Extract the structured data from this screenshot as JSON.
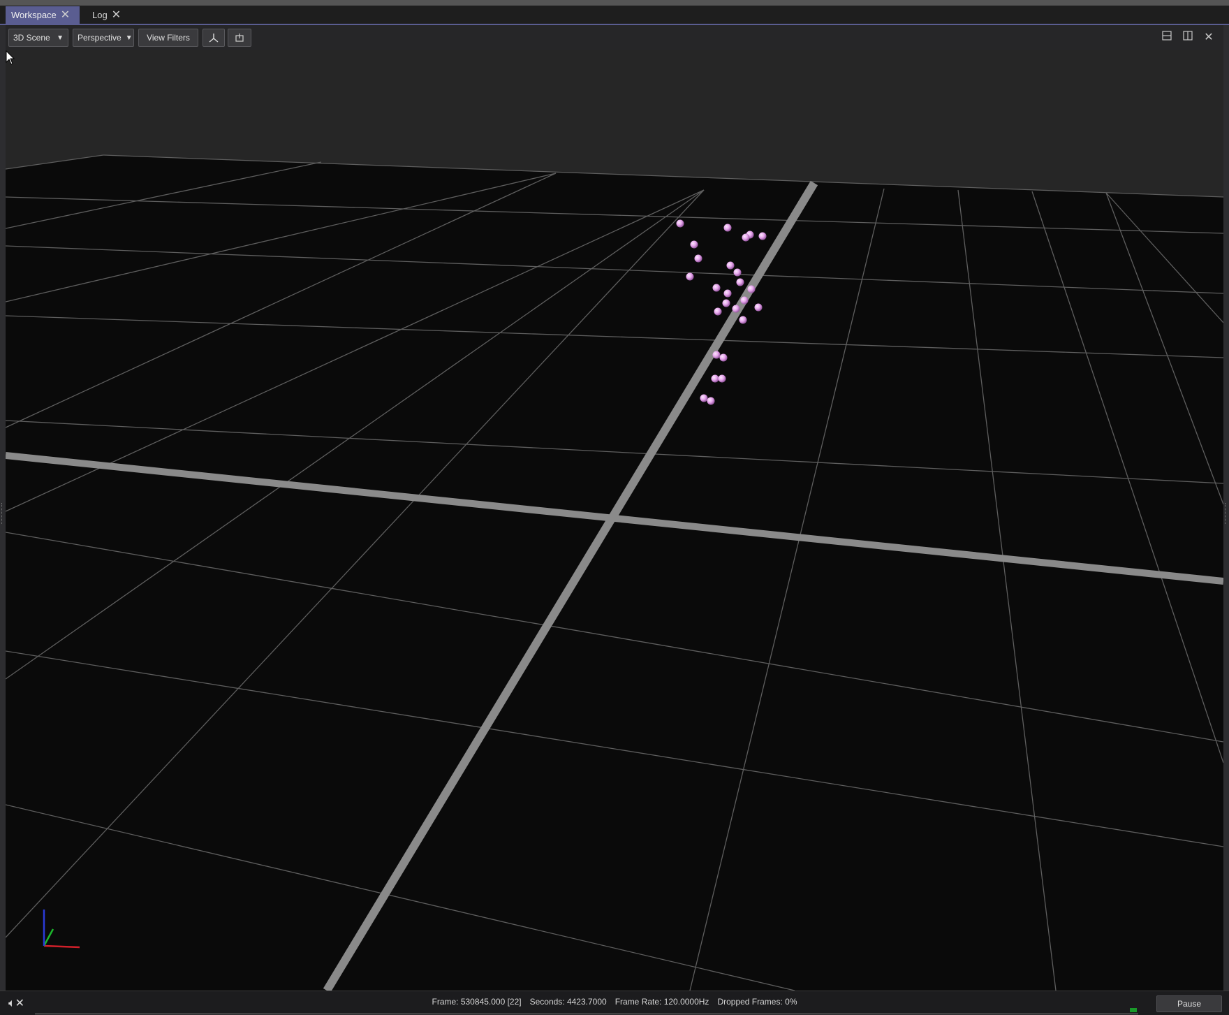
{
  "tabs": [
    {
      "label": "Workspace",
      "active": true
    },
    {
      "label": "Log",
      "active": false
    }
  ],
  "toolbar": {
    "view_select": "3D Scene",
    "projection_select": "Perspective",
    "view_filters_label": "View Filters",
    "axes_icon": "axes-icon",
    "camera_icon": "reset-view-icon"
  },
  "window_controls": {
    "split_horizontal_icon": "split-horizontal-icon",
    "split_vertical_icon": "split-vertical-icon",
    "close_icon": "close-icon"
  },
  "status": {
    "frame": "Frame: 530845.000 [22]",
    "seconds": "Seconds: 4423.7000",
    "frame_rate": "Frame Rate: 120.0000Hz",
    "dropped": "Dropped Frames: 0%",
    "pause_label": "Pause"
  },
  "colors": {
    "accent": "#5a5d91",
    "marker": "#e6a6ec",
    "grid_minor": "#5e5e5e",
    "grid_major": "#8a8a8a",
    "axis_x": "#d0202a",
    "axis_y": "#1cb82c",
    "axis_z": "#2a3ad8"
  },
  "scene": {
    "marker_count": 26
  }
}
